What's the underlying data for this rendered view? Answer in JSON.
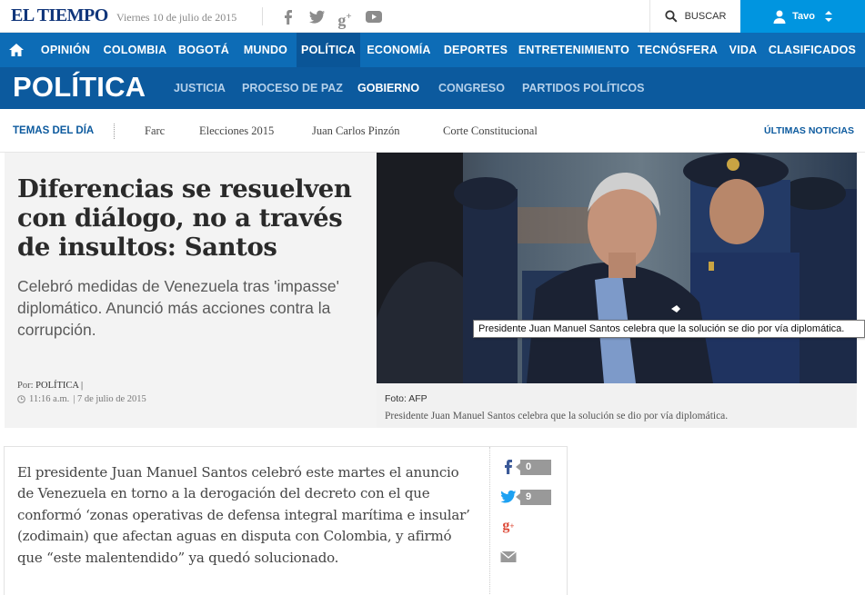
{
  "topbar": {
    "logo": "EL TIEMPO",
    "date": "Viernes 10 de julio de 2015",
    "social_icons": [
      "facebook-icon",
      "twitter-icon",
      "googleplus-icon",
      "youtube-icon"
    ],
    "search_label": "BUSCAR",
    "user_name": "Tavo"
  },
  "mainnav": {
    "items": [
      "OPINIÓN",
      "COLOMBIA",
      "BOGOTÁ",
      "MUNDO",
      "POLÍTICA",
      "ECONOMÍA",
      "DEPORTES",
      "ENTRETENIMIENTO",
      "TECNÓSFERA",
      "VIDA",
      "CLASIFICADOS"
    ],
    "active": "POLÍTICA"
  },
  "section": {
    "title": "POLÍTICA",
    "subnav": [
      "JUSTICIA",
      "PROCESO DE PAZ",
      "GOBIERNO",
      "CONGRESO",
      "PARTIDOS POLÍTICOS"
    ],
    "active": "GOBIERNO"
  },
  "temas": {
    "label": "TEMAS DEL DÍA",
    "items": [
      "Farc",
      "Elecciones 2015",
      "Juan Carlos Pinzón",
      "Corte Constitucional"
    ],
    "ultimas": "ÚLTIMAS NOTICIAS"
  },
  "hero": {
    "headline": "Diferencias se resuelven con diálogo, no a través de insultos: Santos",
    "summary": "Celebró medidas de Venezuela tras 'impasse' diplomático. Anunció más acciones contra la corrupción.",
    "byline_prefix": "Por:",
    "byline_section": "POLÍTICA |",
    "time": "11:16 a.m.",
    "date": "| 7 de julio de 2015",
    "photo_credit": "Foto: AFP",
    "caption": "Presidente Juan Manuel Santos celebra que la solución se dio por vía diplomática.",
    "tooltip": "Presidente Juan Manuel Santos celebra que la solución se dio por vía diplomática."
  },
  "article": {
    "body": "El presidente Juan Manuel Santos celebró este martes el anuncio de Venezuela en torno a la derogación del decreto con el que conformó ‘zonas operativas de defensa integral marítima e insular’ (zodimain) que afectan aguas en disputa con Colombia, y afirmó que “este malentendido” ya quedó solucionado."
  },
  "share": {
    "facebook_count": "0",
    "twitter_count": "9"
  },
  "colors": {
    "brand_blue": "#0d6cb6",
    "section_blue": "#0c5a9e",
    "account_blue": "#0095e0"
  }
}
